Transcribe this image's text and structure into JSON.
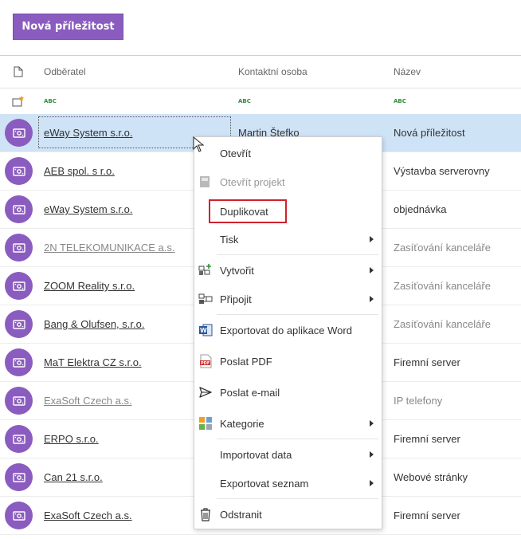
{
  "toolbar": {
    "new_opportunity_label": "Nová příležitost"
  },
  "table": {
    "columns": {
      "odberatel": "Odběratel",
      "kontaktni_osoba": "Kontaktní osoba",
      "nazev": "Název"
    },
    "filter_placeholder": "ABC",
    "rows": [
      {
        "odberatel": "eWay System s.r.o.",
        "kontakt": "Martin Štefko",
        "nazev": "Nová příležitost"
      },
      {
        "odberatel": "AEB spol. s r.o.",
        "kontakt": "",
        "nazev": "Výstavba serverovny"
      },
      {
        "odberatel": "eWay System s.r.o.",
        "kontakt": "",
        "nazev": "objednávka"
      },
      {
        "odberatel": "2N TELEKOMUNIKACE a.s.",
        "kontakt": "",
        "nazev": "Zasíťování kanceláře"
      },
      {
        "odberatel": "ZOOM Reality s.r.o.",
        "kontakt": "",
        "nazev": "Zasíťování kanceláře"
      },
      {
        "odberatel": "Bang & Olufsen, s.r.o.",
        "kontakt": "",
        "nazev": "Zasíťování kanceláře"
      },
      {
        "odberatel": "MaT Elektra CZ s.r.o.",
        "kontakt": "",
        "nazev": "Firemní server"
      },
      {
        "odberatel": "ExaSoft Czech a.s.",
        "kontakt": "",
        "nazev": "IP telefony"
      },
      {
        "odberatel": "ERPO s.r.o.",
        "kontakt": "",
        "nazev": "Firemní server"
      },
      {
        "odberatel": "Can 21 s.r.o.",
        "kontakt": "",
        "nazev": "Webové stránky"
      },
      {
        "odberatel": "ExaSoft Czech a.s.",
        "kontakt": "",
        "nazev": "Firemní server"
      }
    ]
  },
  "context_menu": {
    "items": [
      {
        "label": "Otevřít"
      },
      {
        "label": "Otevřít projekt"
      },
      {
        "label": "Duplikovat"
      },
      {
        "label": "Tisk"
      },
      {
        "label": "Vytvořit"
      },
      {
        "label": "Připojit"
      },
      {
        "label": "Exportovat do aplikace Word"
      },
      {
        "label": "Poslat PDF"
      },
      {
        "label": "Poslat e-mail"
      },
      {
        "label": "Kategorie"
      },
      {
        "label": "Importovat data"
      },
      {
        "label": "Exportovat seznam"
      },
      {
        "label": "Odstranit"
      }
    ]
  },
  "colors": {
    "accent": "#8a5cbf",
    "selection": "#cfe3f7",
    "highlight_box": "#d0212e"
  }
}
